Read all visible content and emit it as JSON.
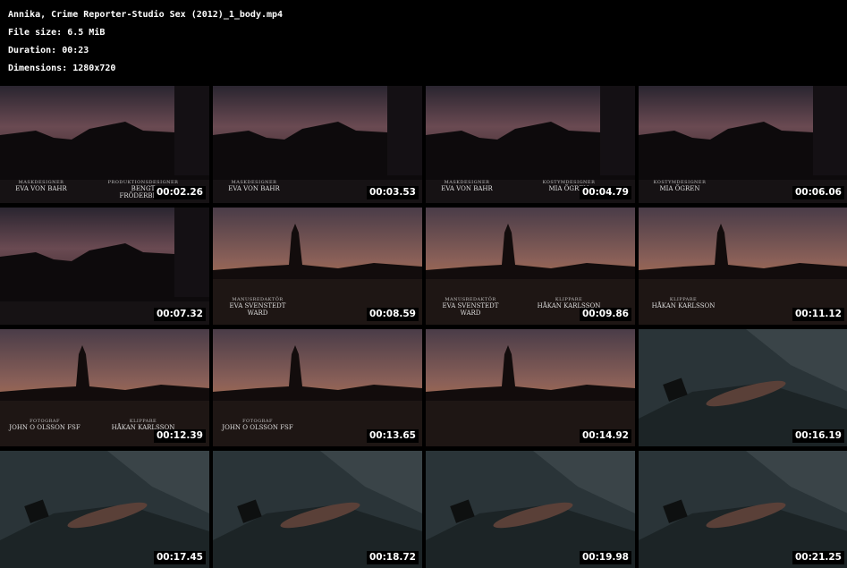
{
  "header": {
    "title": "Annika, Crime Reporter-Studio Sex (2012)_1_body.mp4",
    "file_size": "File size: 6.5 MiB",
    "duration": "Duration: 00:23",
    "dimensions": "Dimensions: 1280x720"
  },
  "thumbnails": [
    {
      "time": "00:02.26",
      "scene": "city",
      "credits": [
        {
          "role": "MASKDESIGNER",
          "name": "EVA VON BAHR"
        },
        {
          "role": "PRODUKTIONSDESIGNER",
          "name": "BENGT FRÖDERBERG"
        }
      ]
    },
    {
      "time": "00:03.53",
      "scene": "city",
      "credits": [
        {
          "role": "MASKDESIGNER",
          "name": "EVA VON BAHR"
        }
      ]
    },
    {
      "time": "00:04.79",
      "scene": "city",
      "credits": [
        {
          "role": "MASKDESIGNER",
          "name": "EVA VON BAHR"
        },
        {
          "role": "KOSTYMDESIGNER",
          "name": "MIA ÖGREN"
        }
      ]
    },
    {
      "time": "00:06.06",
      "scene": "city",
      "credits": [
        {
          "role": "KOSTYMDESIGNER",
          "name": "MIA ÖGREN"
        }
      ]
    },
    {
      "time": "00:07.32",
      "scene": "city",
      "credits": []
    },
    {
      "time": "00:08.59",
      "scene": "tower",
      "credits": [
        {
          "role": "MANUSREDAKTÖR",
          "name": "EVA SVENSTEDT WARD"
        }
      ]
    },
    {
      "time": "00:09.86",
      "scene": "tower",
      "credits": [
        {
          "role": "MANUSREDAKTÖR",
          "name": "EVA SVENSTEDT WARD"
        },
        {
          "role": "KLIPPARE",
          "name": "HÅKAN KARLSSON"
        }
      ]
    },
    {
      "time": "00:11.12",
      "scene": "tower",
      "credits": [
        {
          "role": "KLIPPARE",
          "name": "HÅKAN KARLSSON"
        }
      ]
    },
    {
      "time": "00:12.39",
      "scene": "tower",
      "credits": [
        {
          "role": "FOTOGRAF",
          "name": "JOHN O OLSSON FSF"
        },
        {
          "role": "KLIPPARE",
          "name": "HÅKAN KARLSSON"
        }
      ]
    },
    {
      "time": "00:13.65",
      "scene": "tower",
      "credits": [
        {
          "role": "FOTOGRAF",
          "name": "JOHN O OLSSON FSF"
        }
      ]
    },
    {
      "time": "00:14.92",
      "scene": "tower",
      "credits": []
    },
    {
      "time": "00:16.19",
      "scene": "body",
      "credits": []
    },
    {
      "time": "00:17.45",
      "scene": "body",
      "credits": []
    },
    {
      "time": "00:18.72",
      "scene": "body",
      "credits": []
    },
    {
      "time": "00:19.98",
      "scene": "body",
      "credits": []
    },
    {
      "time": "00:21.25",
      "scene": "body",
      "credits": []
    }
  ]
}
